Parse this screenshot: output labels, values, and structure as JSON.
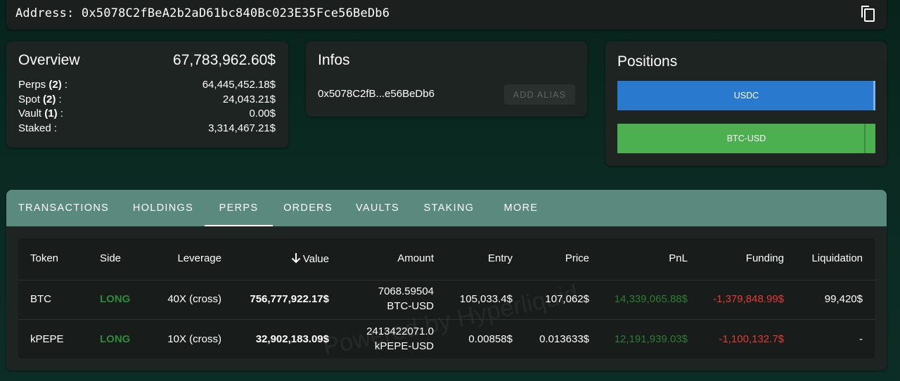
{
  "address": {
    "label": "Address: 0x5078C2fBeA2b2aD61bc840Bc023E35Fce56BeDb6",
    "copy_icon": "copy-icon"
  },
  "overview": {
    "title": "Overview",
    "total": "67,783,962.60$",
    "rows": [
      {
        "label": "Perps",
        "count": "(2)",
        "suffix": " :",
        "value": "64,445,452.18$"
      },
      {
        "label": "Spot",
        "count": "(2)",
        "suffix": " :",
        "value": "24,043.21$"
      },
      {
        "label": "Vault",
        "count": "(1)",
        "suffix": " :",
        "value": "0.00$"
      },
      {
        "label": "Staked :",
        "count": "",
        "suffix": "",
        "value": "3,314,467.21$"
      }
    ]
  },
  "infos": {
    "title": "Infos",
    "short_address": "0x5078C2fB...e56BeDb6",
    "alias_button": "ADD ALIAS"
  },
  "positions": {
    "title": "Positions",
    "bars": [
      {
        "label": "USDC",
        "color": "#2979cf"
      },
      {
        "label": "BTC-USD",
        "color": "#4caf50"
      }
    ]
  },
  "tabs": {
    "items": [
      "TRANSACTIONS",
      "HOLDINGS",
      "PERPS",
      "ORDERS",
      "VAULTS",
      "STAKING",
      "MORE"
    ],
    "active": "PERPS",
    "bar_color": "#5a8a7e"
  },
  "table": {
    "watermark": "Powered by Hyperliquid",
    "sort_icon": "arrow-down-icon",
    "headers": [
      "Token",
      "Side",
      "Leverage",
      "Value",
      "Amount",
      "Entry",
      "Price",
      "PnL",
      "Funding",
      "Liquidation"
    ],
    "rows": [
      {
        "token": "BTC",
        "side": "LONG",
        "leverage": "40X (cross)",
        "value": "756,777,922.17$",
        "amount": "7068.59504",
        "amount_unit": "BTC-USD",
        "entry": "105,033.4$",
        "price": "107,062$",
        "pnl": "14,339,065.88$",
        "funding": "-1,379,848.99$",
        "liquidation": "99,420$"
      },
      {
        "token": "kPEPE",
        "side": "LONG",
        "leverage": "10X (cross)",
        "value": "32,902,183.09$",
        "amount": "2413422071.0",
        "amount_unit": "kPEPE-USD",
        "entry": "0.00858$",
        "price": "0.013633$",
        "pnl": "12,191,939.03$",
        "funding": "-1,100,132.7$",
        "liquidation": "-"
      }
    ],
    "colors": {
      "long": "#2e8b3a",
      "pnl_positive": "#2d7d33",
      "funding_negative": "#e53935"
    }
  }
}
